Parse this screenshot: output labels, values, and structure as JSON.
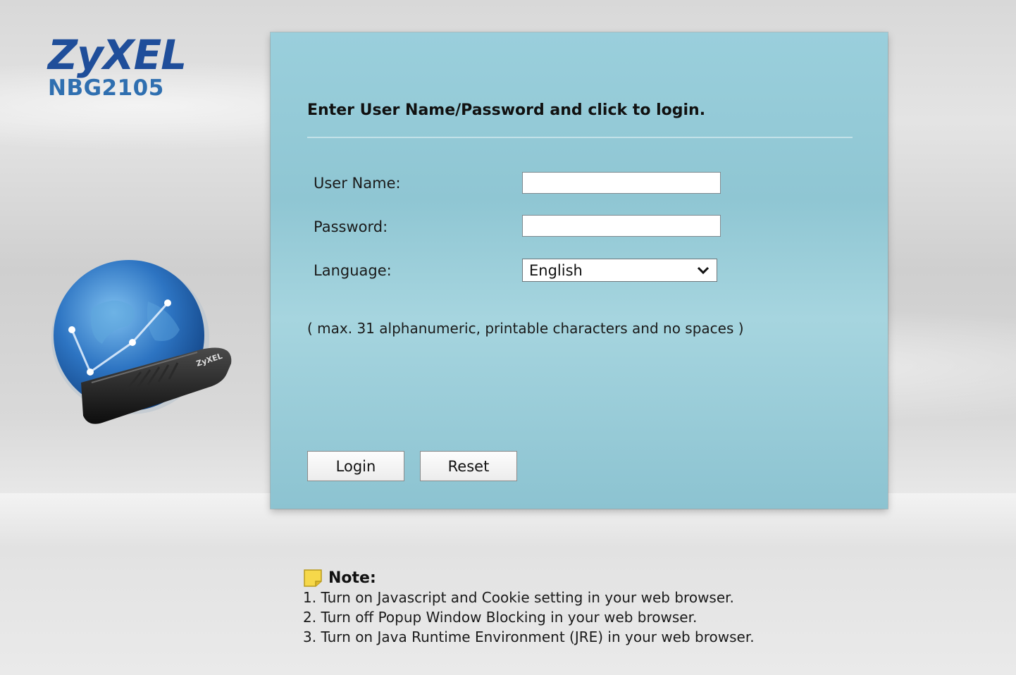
{
  "brand": {
    "logo": "ZyXEL",
    "model": "NBG2105"
  },
  "login": {
    "title": "Enter User Name/Password and click to login.",
    "username_label": "User Name:",
    "username_value": "",
    "password_label": "Password:",
    "password_value": "",
    "language_label": "Language:",
    "language_selected": "English",
    "hint": "( max. 31 alphanumeric, printable characters and no spaces )",
    "login_button": "Login",
    "reset_button": "Reset"
  },
  "note": {
    "title": "Note:",
    "icon": "note-icon",
    "lines": [
      "1. Turn on Javascript and Cookie setting in your web browser.",
      "2. Turn off Popup Window Blocking in your web browser.",
      "3. Turn on Java Runtime Environment (JRE) in your web browser."
    ]
  },
  "colors": {
    "brand_blue": "#1f4e9a",
    "model_blue": "#2f6fb0",
    "panel_teal": "#9acfdc"
  }
}
